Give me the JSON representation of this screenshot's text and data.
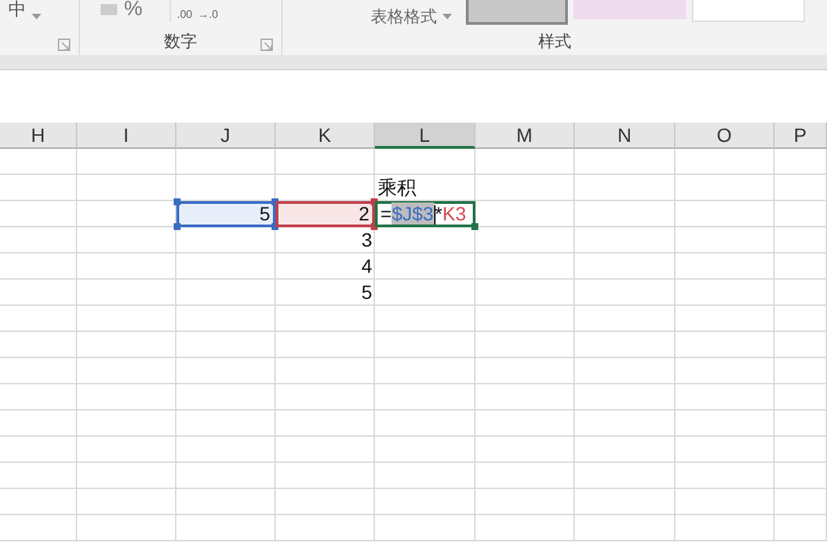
{
  "ribbon": {
    "groups": [
      {
        "kind": "align",
        "items": [
          "中"
        ]
      },
      {
        "kind": "number",
        "items": [
          "%",
          ".00",
          "→.0"
        ],
        "label": "数字"
      },
      {
        "kind": "styles",
        "items": [
          "表格格式"
        ],
        "label": "样式"
      }
    ]
  },
  "columns": [
    {
      "label": "H",
      "selected": false
    },
    {
      "label": "I",
      "selected": false
    },
    {
      "label": "J",
      "selected": false
    },
    {
      "label": "K",
      "selected": false
    },
    {
      "label": "L",
      "selected": true
    },
    {
      "label": "M",
      "selected": false
    },
    {
      "label": "N",
      "selected": false
    },
    {
      "label": "O",
      "selected": false
    },
    {
      "label": "P",
      "selected": false
    }
  ],
  "rows": [
    {
      "cells": [
        {},
        {},
        {},
        {},
        {},
        {},
        {},
        {},
        {}
      ]
    },
    {
      "cells": [
        {},
        {},
        {},
        {},
        {
          "kind": "label",
          "text": "乘积"
        },
        {},
        {},
        {},
        {}
      ]
    },
    {
      "cells": [
        {},
        {},
        {
          "kind": "abs-ref",
          "text": "5"
        },
        {
          "kind": "rel-ref",
          "text": "2"
        },
        {
          "kind": "formula",
          "parts": [
            {
              "kind": "plain",
              "text": "=",
              "selected": false
            },
            {
              "kind": "abs-ref",
              "text": "$J$3",
              "selected": true
            },
            {
              "kind": "plain",
              "text": "*",
              "selected": false
            },
            {
              "kind": "rel-ref",
              "text": "K3",
              "selected": false
            }
          ]
        },
        {},
        {},
        {},
        {}
      ]
    },
    {
      "cells": [
        {},
        {},
        {},
        {
          "kind": "number",
          "text": "3"
        },
        {},
        {},
        {},
        {},
        {}
      ]
    },
    {
      "cells": [
        {},
        {},
        {},
        {
          "kind": "number",
          "text": "4"
        },
        {},
        {},
        {},
        {},
        {}
      ]
    },
    {
      "cells": [
        {},
        {},
        {},
        {
          "kind": "number",
          "text": "5"
        },
        {},
        {},
        {},
        {},
        {}
      ]
    }
  ]
}
